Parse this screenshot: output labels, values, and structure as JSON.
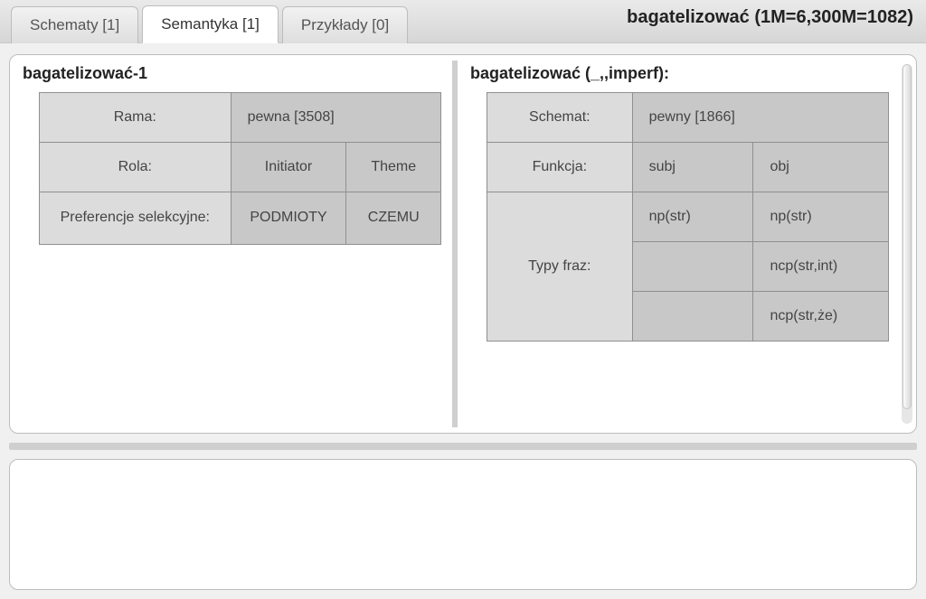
{
  "header": {
    "title": "bagatelizować (1M=6,300M=1082)"
  },
  "tabs": [
    {
      "label": "Schematy [1]",
      "active": false
    },
    {
      "label": "Semantyka [1]",
      "active": true
    },
    {
      "label": "Przykłady [0]",
      "active": false
    }
  ],
  "leftPanel": {
    "title": "bagatelizować-1",
    "rows": {
      "rama": {
        "label": "Rama:",
        "value": "pewna [3508]"
      },
      "rola": {
        "label": "Rola:",
        "v1": "Initiator",
        "v2": "Theme"
      },
      "pref": {
        "label": "Preferencje selekcyjne:",
        "v1": "PODMIOTY",
        "v2": "CZEMU"
      }
    }
  },
  "rightPanel": {
    "title": "bagatelizować (_,,imperf):",
    "rows": {
      "schemat": {
        "label": "Schemat:",
        "value": "pewny [1866]"
      },
      "funkcja": {
        "label": "Funkcja:",
        "v1": "subj",
        "v2": "obj"
      },
      "typy": {
        "label": "Typy fraz:",
        "r1c1": "np(str)",
        "r1c2": "np(str)",
        "r2c1": "",
        "r2c2": "ncp(str,int)",
        "r3c1": "",
        "r3c2": "ncp(str,że)"
      }
    }
  }
}
